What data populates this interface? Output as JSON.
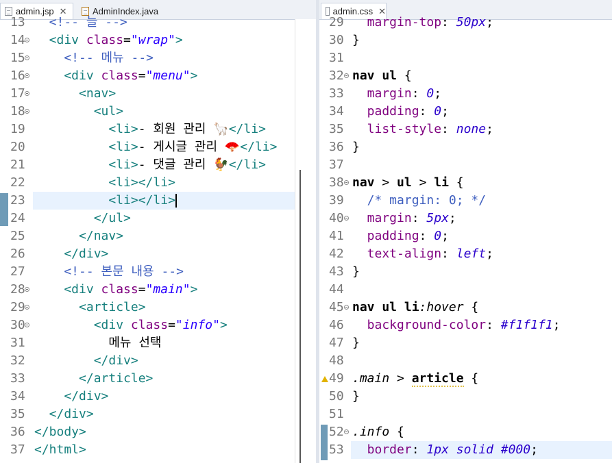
{
  "left_tabs": [
    {
      "label": "admin.jsp",
      "active": true,
      "icon": "jsp-file-icon"
    },
    {
      "label": "AdminIndex.java",
      "active": false,
      "icon": "java-file-icon"
    }
  ],
  "right_tabs": [
    {
      "label": "admin.css",
      "active": true,
      "icon": "css-file-icon"
    }
  ],
  "left_lines": [
    {
      "n": "13",
      "fold": false,
      "parts": [
        [
          "cmt",
          "  <!-- 늘 -->"
        ]
      ]
    },
    {
      "n": "14",
      "fold": true,
      "parts": [
        [
          "tag",
          "  <div "
        ],
        [
          "attr",
          "class"
        ],
        [
          "pun",
          "="
        ],
        [
          "str",
          "\"wrap\""
        ],
        [
          "tag",
          ">"
        ]
      ]
    },
    {
      "n": "15",
      "fold": true,
      "parts": [
        [
          "cmt",
          "    <!-- 메뉴 -->"
        ]
      ]
    },
    {
      "n": "16",
      "fold": true,
      "parts": [
        [
          "tag",
          "    <div "
        ],
        [
          "attr",
          "class"
        ],
        [
          "pun",
          "="
        ],
        [
          "str",
          "\"menu\""
        ],
        [
          "tag",
          ">"
        ]
      ]
    },
    {
      "n": "17",
      "fold": true,
      "parts": [
        [
          "tag",
          "      <nav>"
        ]
      ]
    },
    {
      "n": "18",
      "fold": true,
      "parts": [
        [
          "tag",
          "        <ul>"
        ]
      ]
    },
    {
      "n": "19",
      "fold": false,
      "parts": [
        [
          "tag",
          "          <li>"
        ],
        [
          "txt",
          "- 회원 관리 🦙"
        ],
        [
          "tag",
          "</li>"
        ]
      ]
    },
    {
      "n": "20",
      "fold": false,
      "parts": [
        [
          "tag",
          "          <li>"
        ],
        [
          "txt",
          "- 게시글 관리 🪭"
        ],
        [
          "tag",
          "</li>"
        ]
      ]
    },
    {
      "n": "21",
      "fold": false,
      "parts": [
        [
          "tag",
          "          <li>"
        ],
        [
          "txt",
          "- 댓글 관리 🐓"
        ],
        [
          "tag",
          "</li>"
        ]
      ]
    },
    {
      "n": "22",
      "fold": false,
      "parts": [
        [
          "tag",
          "          <li></li>"
        ]
      ]
    },
    {
      "n": "23",
      "fold": false,
      "highlight": true,
      "parts": [
        [
          "tag",
          "          <li></li>"
        ]
      ]
    },
    {
      "n": "24",
      "fold": false,
      "parts": [
        [
          "tag",
          "        </ul>"
        ]
      ]
    },
    {
      "n": "25",
      "fold": false,
      "parts": [
        [
          "tag",
          "      </nav>"
        ]
      ]
    },
    {
      "n": "26",
      "fold": false,
      "parts": [
        [
          "tag",
          "    </div>"
        ]
      ]
    },
    {
      "n": "27",
      "fold": false,
      "parts": [
        [
          "cmt",
          "    <!-- 본문 내용 -->"
        ]
      ]
    },
    {
      "n": "28",
      "fold": true,
      "parts": [
        [
          "tag",
          "    <div "
        ],
        [
          "attr",
          "class"
        ],
        [
          "pun",
          "="
        ],
        [
          "str",
          "\"main\""
        ],
        [
          "tag",
          ">"
        ]
      ]
    },
    {
      "n": "29",
      "fold": true,
      "parts": [
        [
          "tag",
          "      <article>"
        ]
      ]
    },
    {
      "n": "30",
      "fold": true,
      "parts": [
        [
          "tag",
          "        <div "
        ],
        [
          "attr",
          "class"
        ],
        [
          "pun",
          "="
        ],
        [
          "str",
          "\"info\""
        ],
        [
          "tag",
          ">"
        ]
      ]
    },
    {
      "n": "31",
      "fold": false,
      "parts": [
        [
          "txt",
          "          메뉴 선택"
        ]
      ]
    },
    {
      "n": "32",
      "fold": false,
      "parts": [
        [
          "tag",
          "        </div>"
        ]
      ]
    },
    {
      "n": "33",
      "fold": false,
      "parts": [
        [
          "tag",
          "      </article>"
        ]
      ]
    },
    {
      "n": "34",
      "fold": false,
      "parts": [
        [
          "tag",
          "    </div>"
        ]
      ]
    },
    {
      "n": "35",
      "fold": false,
      "parts": [
        [
          "tag",
          "  </div>"
        ]
      ]
    },
    {
      "n": "36",
      "fold": false,
      "parts": [
        [
          "tag",
          "</body>"
        ]
      ]
    },
    {
      "n": "37",
      "fold": false,
      "parts": [
        [
          "tag",
          "</html>"
        ]
      ]
    }
  ],
  "right_lines": [
    {
      "n": "29",
      "fold": false,
      "parts": [
        [
          "prop",
          "  margin-top"
        ],
        [
          "pun",
          ": "
        ],
        [
          "val",
          "50px"
        ],
        [
          "pun",
          ";"
        ]
      ]
    },
    {
      "n": "30",
      "fold": false,
      "parts": [
        [
          "pun",
          "}"
        ]
      ]
    },
    {
      "n": "31",
      "fold": false,
      "parts": []
    },
    {
      "n": "32",
      "fold": true,
      "parts": [
        [
          "sel",
          "nav ul "
        ],
        [
          "pun",
          "{"
        ]
      ]
    },
    {
      "n": "33",
      "fold": false,
      "parts": [
        [
          "prop",
          "  margin"
        ],
        [
          "pun",
          ": "
        ],
        [
          "val",
          "0"
        ],
        [
          "pun",
          ";"
        ]
      ]
    },
    {
      "n": "34",
      "fold": false,
      "parts": [
        [
          "prop",
          "  padding"
        ],
        [
          "pun",
          ": "
        ],
        [
          "val",
          "0"
        ],
        [
          "pun",
          ";"
        ]
      ]
    },
    {
      "n": "35",
      "fold": false,
      "parts": [
        [
          "prop",
          "  list-style"
        ],
        [
          "pun",
          ": "
        ],
        [
          "val",
          "none"
        ],
        [
          "pun",
          ";"
        ]
      ]
    },
    {
      "n": "36",
      "fold": false,
      "parts": [
        [
          "pun",
          "}"
        ]
      ]
    },
    {
      "n": "37",
      "fold": false,
      "parts": []
    },
    {
      "n": "38",
      "fold": true,
      "parts": [
        [
          "sel",
          "nav "
        ],
        [
          "pun",
          "> "
        ],
        [
          "sel",
          "ul "
        ],
        [
          "pun",
          "> "
        ],
        [
          "sel",
          "li "
        ],
        [
          "pun",
          "{"
        ]
      ]
    },
    {
      "n": "39",
      "fold": false,
      "parts": [
        [
          "cmt",
          "  /* margin: 0; */"
        ]
      ]
    },
    {
      "n": "40",
      "fold": true,
      "parts": [
        [
          "prop",
          "  margin"
        ],
        [
          "pun",
          ": "
        ],
        [
          "val",
          "5px"
        ],
        [
          "pun",
          ";"
        ]
      ]
    },
    {
      "n": "41",
      "fold": false,
      "parts": [
        [
          "prop",
          "  padding"
        ],
        [
          "pun",
          ": "
        ],
        [
          "val",
          "0"
        ],
        [
          "pun",
          ";"
        ]
      ]
    },
    {
      "n": "42",
      "fold": false,
      "parts": [
        [
          "prop",
          "  text-align"
        ],
        [
          "pun",
          ": "
        ],
        [
          "val",
          "left"
        ],
        [
          "pun",
          ";"
        ]
      ]
    },
    {
      "n": "43",
      "fold": false,
      "parts": [
        [
          "pun",
          "}"
        ]
      ]
    },
    {
      "n": "44",
      "fold": false,
      "parts": []
    },
    {
      "n": "45",
      "fold": true,
      "parts": [
        [
          "sel",
          "nav ul li"
        ],
        [
          "pcl",
          ":hover"
        ],
        [
          "pun",
          " {"
        ]
      ]
    },
    {
      "n": "46",
      "fold": false,
      "parts": [
        [
          "prop",
          "  background-color"
        ],
        [
          "pun",
          ": "
        ],
        [
          "val",
          "#f1f1f1"
        ],
        [
          "pun",
          ";"
        ]
      ]
    },
    {
      "n": "47",
      "fold": false,
      "parts": [
        [
          "pun",
          "}"
        ]
      ]
    },
    {
      "n": "48",
      "fold": false,
      "parts": []
    },
    {
      "n": "49",
      "fold": false,
      "warn": true,
      "parts": [
        [
          "pcl",
          ".main"
        ],
        [
          "pun",
          " > "
        ],
        [
          "sel",
          "article"
        ],
        [
          "pun",
          " {"
        ]
      ]
    },
    {
      "n": "50",
      "fold": false,
      "parts": [
        [
          "pun",
          "}"
        ]
      ]
    },
    {
      "n": "51",
      "fold": false,
      "parts": []
    },
    {
      "n": "52",
      "fold": true,
      "parts": [
        [
          "pcl",
          ".info"
        ],
        [
          "pun",
          " {"
        ]
      ]
    },
    {
      "n": "53",
      "fold": false,
      "highlight": true,
      "parts": [
        [
          "prop",
          "  border"
        ],
        [
          "pun",
          ": "
        ],
        [
          "val",
          "1px solid #000"
        ],
        [
          "pun",
          ";"
        ]
      ]
    }
  ]
}
